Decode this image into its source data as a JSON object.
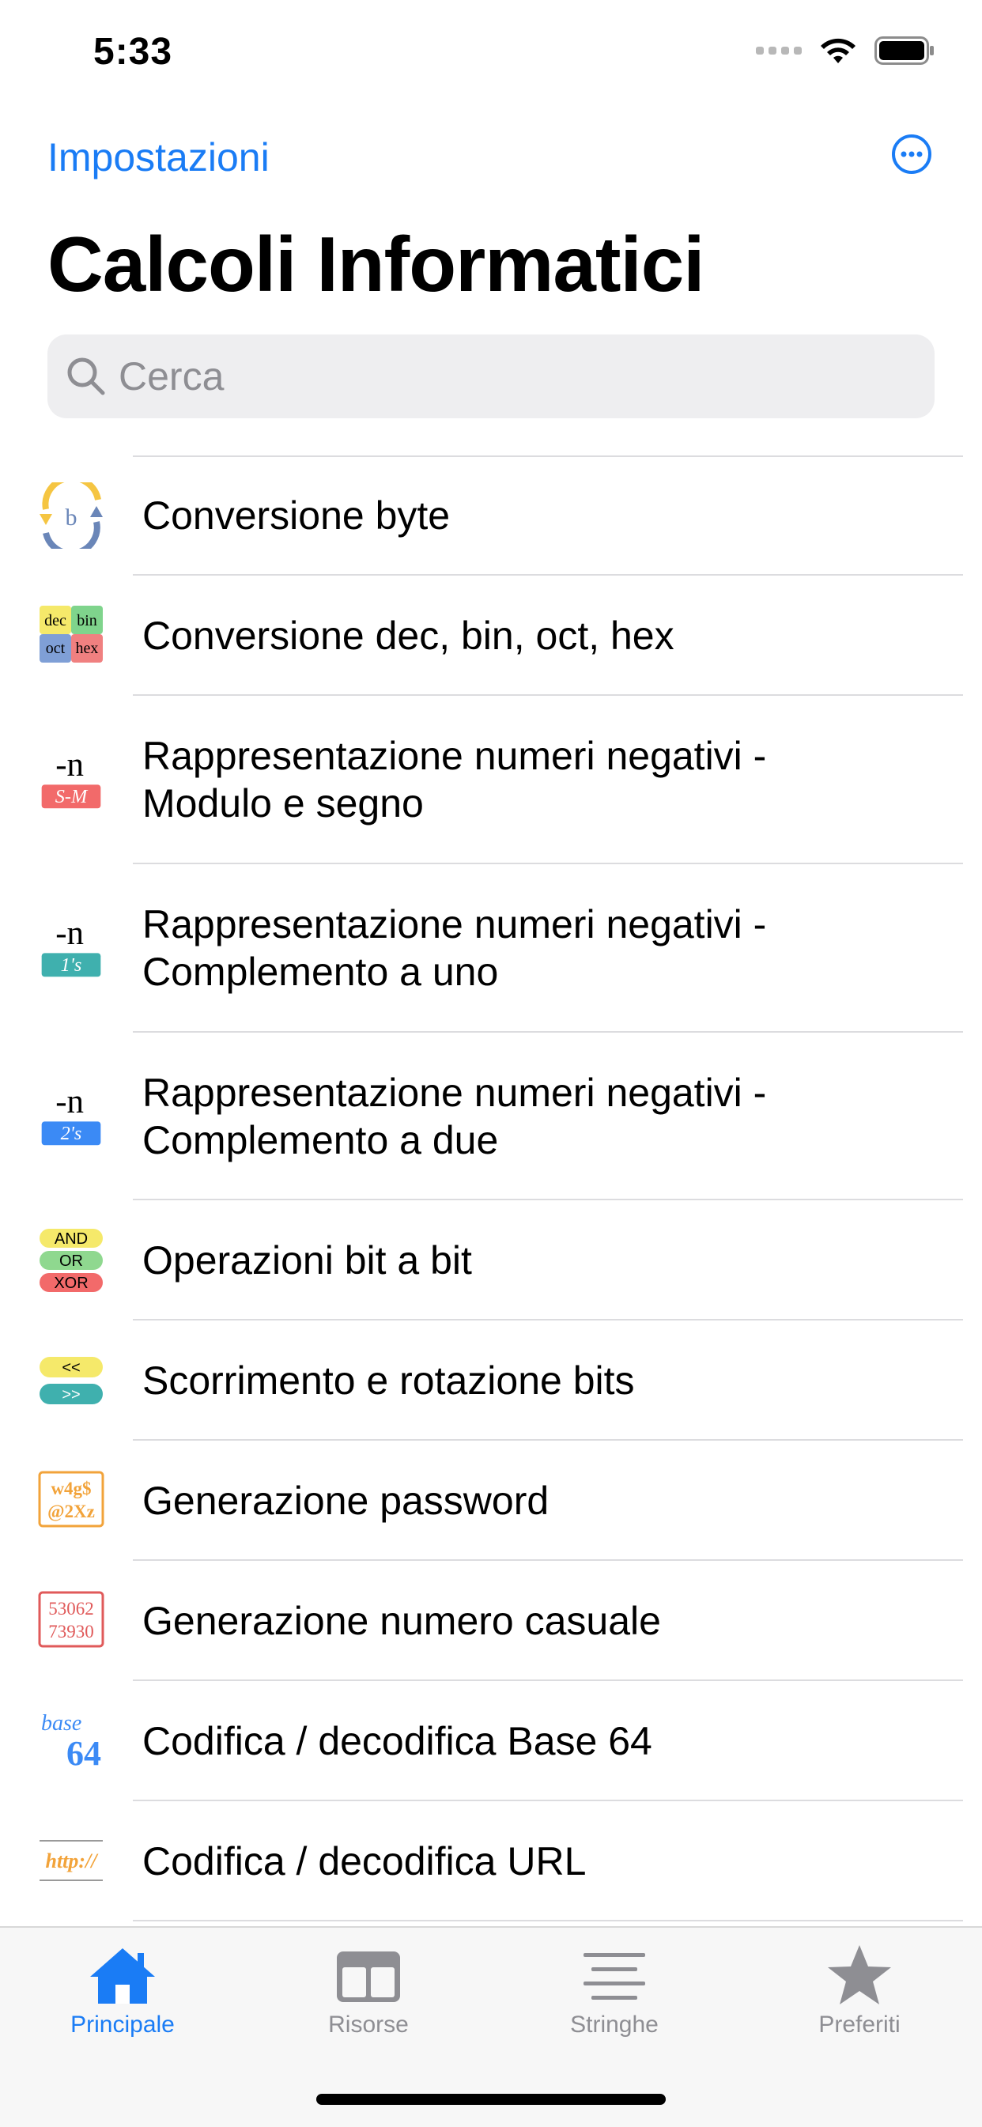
{
  "status": {
    "time": "5:33"
  },
  "nav": {
    "settings_label": "Impostazioni",
    "more_icon": "ellipsis-circle-icon"
  },
  "title": "Calcoli Informatici",
  "search": {
    "placeholder": "Cerca",
    "value": ""
  },
  "list": [
    {
      "label_lines": [
        "Conversione byte"
      ],
      "icon": "byte-conversion-icon"
    },
    {
      "label_lines": [
        "Conversione dec, bin, oct, hex"
      ],
      "icon": "base-conversion-icon",
      "icon_text": [
        "dec",
        "bin",
        "oct",
        "hex"
      ]
    },
    {
      "label_lines": [
        "Rappresentazione numeri negativi -",
        "Modulo e segno"
      ],
      "icon": "sign-magnitude-icon",
      "icon_text": [
        "-n",
        "S-M"
      ]
    },
    {
      "label_lines": [
        "Rappresentazione numeri negativi -",
        "Complemento a uno"
      ],
      "icon": "ones-complement-icon",
      "icon_text": [
        "-n",
        "1's"
      ]
    },
    {
      "label_lines": [
        "Rappresentazione numeri negativi -",
        "Complemento a due"
      ],
      "icon": "twos-complement-icon",
      "icon_text": [
        "-n",
        "2's"
      ]
    },
    {
      "label_lines": [
        "Operazioni bit a bit"
      ],
      "icon": "bitwise-operations-icon",
      "icon_text": [
        "AND",
        "OR",
        "XOR"
      ]
    },
    {
      "label_lines": [
        "Scorrimento e rotazione bits"
      ],
      "icon": "bit-shift-icon",
      "icon_text": [
        "<<",
        ">>"
      ]
    },
    {
      "label_lines": [
        "Generazione password"
      ],
      "icon": "password-generator-icon",
      "icon_text": [
        "w4g$",
        "@2Xz"
      ]
    },
    {
      "label_lines": [
        "Generazione numero casuale"
      ],
      "icon": "random-number-icon",
      "icon_text": [
        "53062",
        "73930"
      ]
    },
    {
      "label_lines": [
        "Codifica / decodifica Base 64"
      ],
      "icon": "base64-icon",
      "icon_text": [
        "base",
        "64"
      ]
    },
    {
      "label_lines": [
        "Codifica / decodifica URL"
      ],
      "icon": "url-encoding-icon",
      "icon_text": [
        "http://"
      ]
    }
  ],
  "tabs": [
    {
      "label": "Principale",
      "icon": "house-icon",
      "active": true
    },
    {
      "label": "Risorse",
      "icon": "resources-icon",
      "active": false
    },
    {
      "label": "Stringhe",
      "icon": "text-lines-icon",
      "active": false
    },
    {
      "label": "Preferiti",
      "icon": "star-icon",
      "active": false
    }
  ],
  "colors": {
    "accent": "#1a7cf5",
    "inactive_tab": "#8e8e93",
    "divider": "#dcdcdf",
    "search_bg": "#eeeef0"
  }
}
